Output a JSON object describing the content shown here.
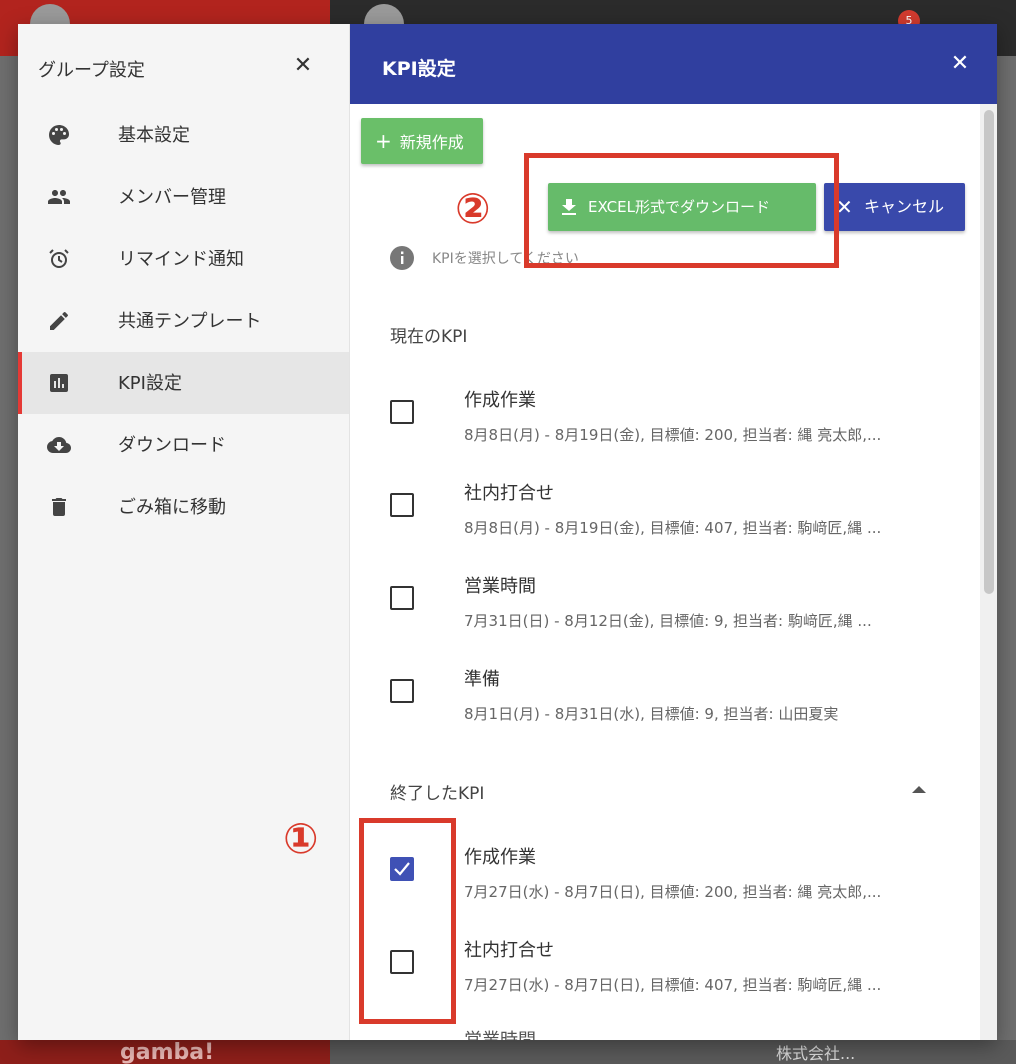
{
  "background": {
    "badge_count": "5",
    "logo_text": "gamba!",
    "company_text": "株式会社..."
  },
  "sidebar": {
    "title": "グループ設定",
    "close_icon": "close-icon",
    "items": [
      {
        "label": "基本設定",
        "icon": "palette-icon"
      },
      {
        "label": "メンバー管理",
        "icon": "people-icon"
      },
      {
        "label": "リマインド通知",
        "icon": "alarm-icon"
      },
      {
        "label": "共通テンプレート",
        "icon": "pencil-icon"
      },
      {
        "label": "KPI設定",
        "icon": "chart-icon",
        "active": true
      },
      {
        "label": "ダウンロード",
        "icon": "cloud-download-icon"
      },
      {
        "label": "ごみ箱に移動",
        "icon": "trash-icon"
      }
    ]
  },
  "main": {
    "title": "KPI設定",
    "new_button": "新規作成",
    "excel_button": "EXCEL形式でダウンロード",
    "cancel_button": "キャンセル",
    "info_text": "KPIを選択してください",
    "current_section": "現在のKPI",
    "ended_section": "終了したKPI",
    "current_kpis": [
      {
        "name": "作成作業",
        "detail": "8月8日(月) - 8月19日(金), 目標値: 200, 担当者: 縄 亮太郎,...",
        "checked": false
      },
      {
        "name": "社内打合せ",
        "detail": "8月8日(月) - 8月19日(金), 目標値: 407, 担当者: 駒﨑匠,縄 ...",
        "checked": false
      },
      {
        "name": "営業時間",
        "detail": "7月31日(日) - 8月12日(金), 目標値: 9, 担当者: 駒﨑匠,縄 ...",
        "checked": false
      },
      {
        "name": "準備",
        "detail": "8月1日(月) - 8月31日(水), 目標値: 9, 担当者: 山田夏実",
        "checked": false
      }
    ],
    "ended_kpis": [
      {
        "name": "作成作業",
        "detail": "7月27日(水) - 8月7日(日), 目標値: 200, 担当者: 縄 亮太郎,...",
        "checked": true
      },
      {
        "name": "社内打合せ",
        "detail": "7月27日(水) - 8月7日(日), 目標値: 407, 担当者: 駒﨑匠,縄 ...",
        "checked": false
      }
    ],
    "next_item_partial": "営業時間"
  },
  "annotations": {
    "one": "①",
    "two": "②",
    "color": "#d93a2b"
  },
  "colors": {
    "header": "#303f9f",
    "green_button": "#66bb6a",
    "cancel_button": "#3949ab",
    "active_indicator": "#e53935"
  }
}
